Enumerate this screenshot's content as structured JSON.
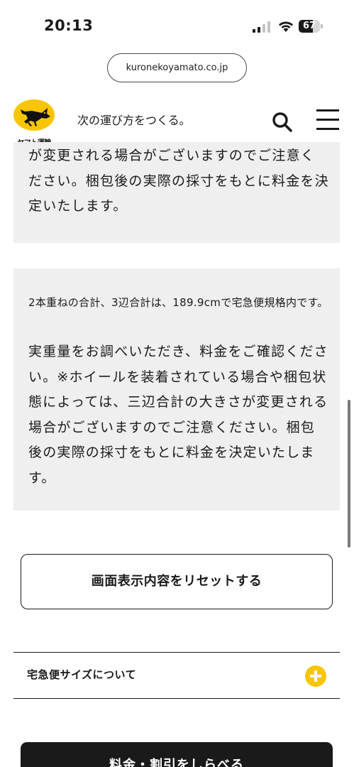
{
  "status_bar": {
    "time": "20:13",
    "battery_level": "67",
    "battery_fraction": 0.67,
    "icons": [
      "cellular-signal-icon",
      "wifi-icon",
      "battery-icon"
    ]
  },
  "browser": {
    "url": "kuronekoyamato.co.jp"
  },
  "header": {
    "logo_text": "ヤマト運輸",
    "tagline": "次の運び方をつくる。",
    "icons": [
      "search-icon",
      "hamburger-menu-icon"
    ],
    "brand_color": "#f7c600"
  },
  "cards": [
    {
      "text": "が変更される場合がございますのでご注意ください。梱包後の実際の採寸をもとに料金を決定いたします。"
    },
    {
      "note": "2本重ねの合計、3辺合計は、189.9cmで宅急便規格内です。",
      "text": "実重量をお調べいただき、料金をご確認ください。※ホイールを装着されている場合や梱包状態によっては、三辺合計の大きさが変更される場合がございますのでご注意ください。梱包後の実際の採寸をもとに料金を決定いたします。"
    }
  ],
  "reset_button": {
    "label": "画面表示内容をリセットする"
  },
  "accordion": {
    "label": "宅急便サイズについて",
    "icon": "plus-circle-icon",
    "icon_color": "#f7c600"
  },
  "bottom_button": {
    "label": "料金・割引をしらべる"
  }
}
